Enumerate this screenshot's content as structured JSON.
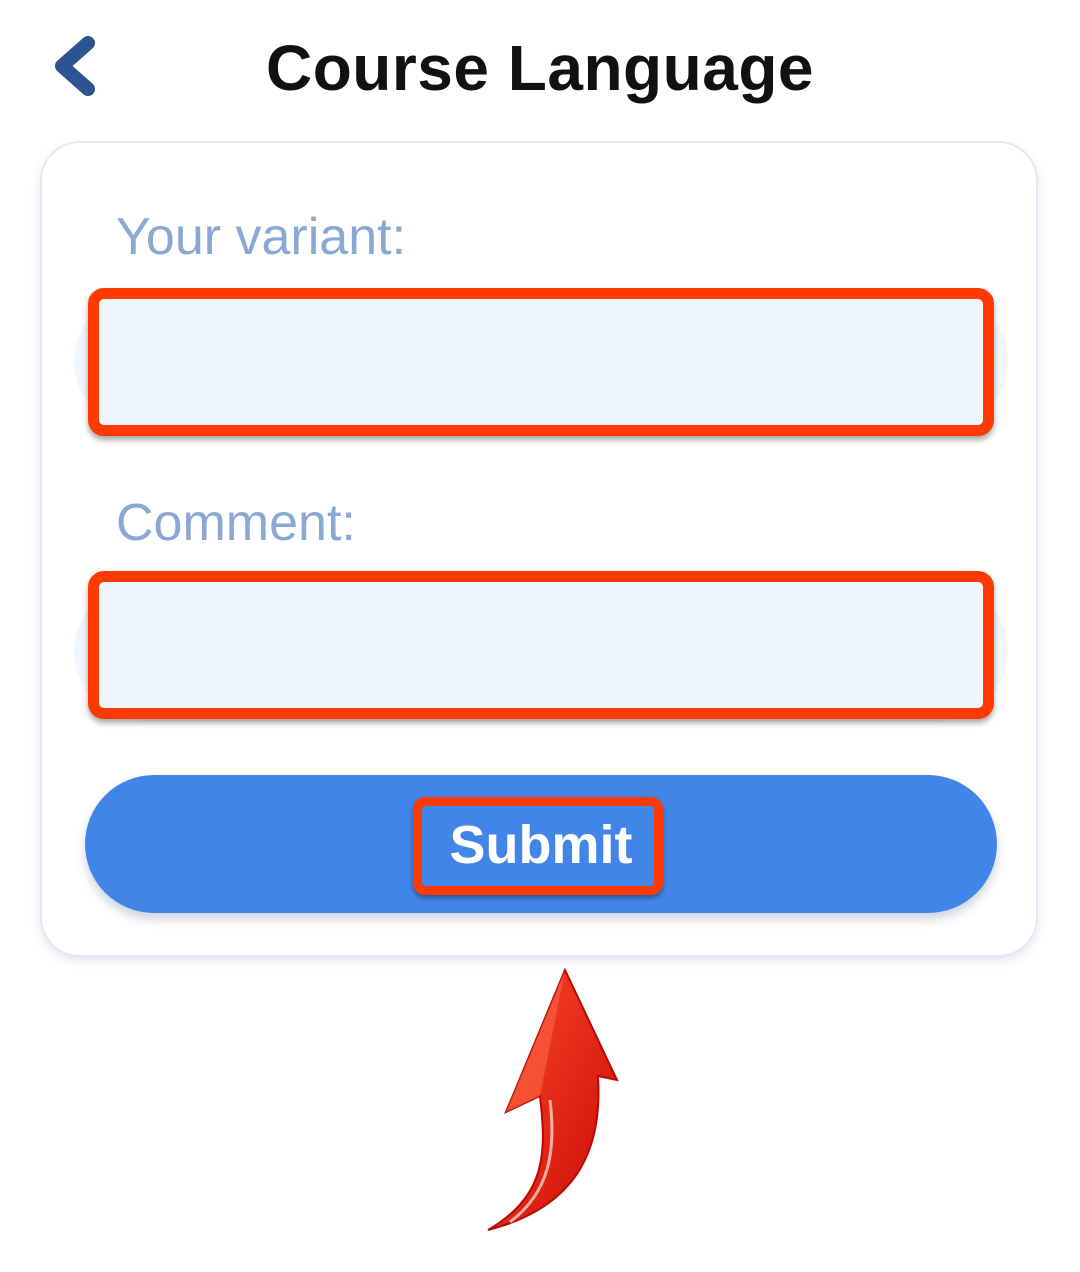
{
  "header": {
    "title": "Course Language",
    "back_icon": "chevron-left-icon",
    "back_icon_color": "#2c5491"
  },
  "form": {
    "variant_label": "Your variant:",
    "variant_value": "",
    "comment_label": "Comment:",
    "comment_value": "",
    "submit_label": "Submit"
  },
  "annotation": {
    "highlight_color": "#ff3a00",
    "arrow_icon": "curved-up-arrow-icon",
    "arrow_color": "#e8140a"
  },
  "colors": {
    "accent": "#4285e8",
    "label": "#8aa8d4",
    "input_background": "#f0f6fd"
  }
}
